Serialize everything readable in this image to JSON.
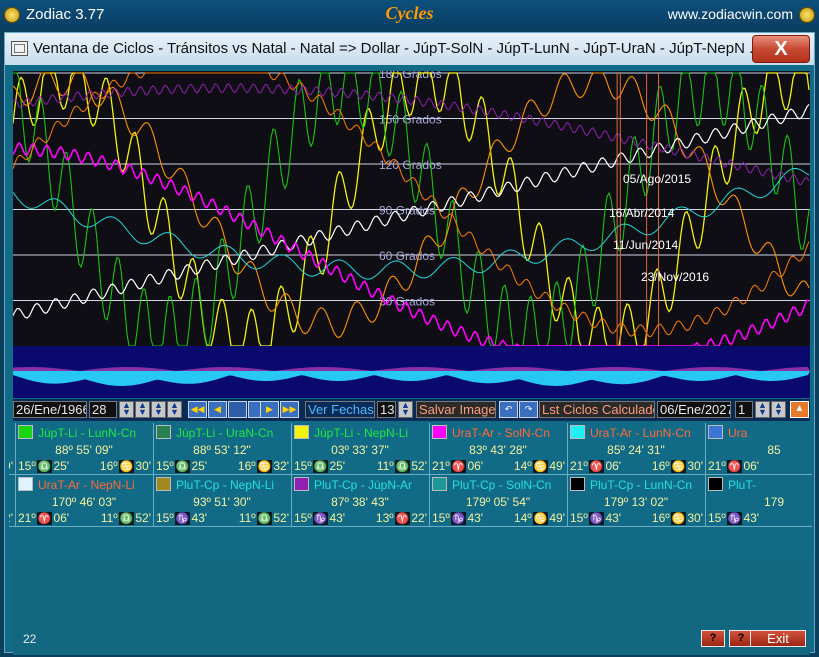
{
  "app": {
    "name": "Zodiac 3.77",
    "module": "Cycles",
    "url": "www.zodiacwin.com"
  },
  "window": {
    "title": "Ventana de Ciclos - Tránsitos vs Natal - Natal => Dollar - JúpT-SolN - JúpT-LunN - JúpT-UraN - JúpT-NepN ...",
    "close": "X"
  },
  "chart_data": {
    "type": "line",
    "y_unit": "Grados",
    "ylim": [
      0,
      180
    ],
    "grid_lines": [
      {
        "value": 180,
        "label": "180 Grados"
      },
      {
        "value": 150,
        "label": "150 Grados"
      },
      {
        "value": 120,
        "label": "120 Grados"
      },
      {
        "value": 90,
        "label": "90 Grados"
      },
      {
        "value": 60,
        "label": "60 Grados"
      },
      {
        "value": 30,
        "label": "30 Grados"
      }
    ],
    "date_markers": [
      {
        "date": "05/Ago/2015",
        "x_frac": 0.795
      },
      {
        "date": "16/Abr/2014",
        "x_frac": 0.758
      },
      {
        "date": "11/Jun/2014",
        "x_frac": 0.762
      },
      {
        "date": "23/Nov/2016",
        "x_frac": 0.81
      }
    ],
    "series_colors": {
      "JúpT-SolN": "#ff9100",
      "JúpT-LunN": "#18c414",
      "JúpT-UraN": "#30a060",
      "JúpT-NepN": "#f2f20e",
      "UraT-SolN": "#ff00ff",
      "UraT-LunN": "#20d8d8",
      "UraT-NepN": "#ffffff",
      "PluT-NepN": "#a08a20",
      "PluT-JúpN": "#9020b0",
      "PluT-SolN": "#209898",
      "PluT-LunN": "#303030"
    }
  },
  "toolbar": {
    "start_date": "26/Ene/1966",
    "step": "28",
    "ver_fechas": "Ver Fechas",
    "ver_count": "13",
    "save_image": "Salvar Imagen",
    "list_calc": "Lst Ciclos Calculados",
    "end_date": "06/Ene/2027",
    "end_step": "1"
  },
  "rows": [
    [
      {
        "title": "-SolN-Cn",
        "title_color": "#25e0e0",
        "value": "",
        "left": "13\"",
        "left_glyph": "",
        "right": "14º",
        "right_glyph": "♋",
        "right_min": "49'",
        "swatch": ""
      },
      {
        "title": "JúpT-Li - LunN-Cn",
        "title_color": "#20e840",
        "value": "88º 55' 09\"",
        "left": "15º",
        "left_glyph": "♎",
        "left_min": "25'",
        "right": "16º",
        "right_glyph": "♋",
        "right_min": "30'",
        "swatch": "#18d414"
      },
      {
        "title": "JúpT-Li - UraN-Cn",
        "title_color": "#20e840",
        "value": "88º 53' 12\"",
        "left": "15º",
        "left_glyph": "♎",
        "left_min": "25'",
        "right": "16º",
        "right_glyph": "♋",
        "right_min": "32'",
        "swatch": "#2a8050"
      },
      {
        "title": "JúpT-Li - NepN-Li",
        "title_color": "#20e840",
        "value": "03º 33' 37\"",
        "left": "15º",
        "left_glyph": "♎",
        "left_min": "25'",
        "right": "11º",
        "right_glyph": "♎",
        "right_min": "52'",
        "swatch": "#f2f20e"
      },
      {
        "title": "UraT-Ar - SolN-Cn",
        "title_color": "#ff6a3a",
        "value": "83º 43' 28\"",
        "left": "21º",
        "left_glyph": "♈",
        "left_min": "06'",
        "right": "14º",
        "right_glyph": "♋",
        "right_min": "49'",
        "swatch": "#ff00ff"
      },
      {
        "title": "UraT-Ar - LunN-Cn",
        "title_color": "#ff6a3a",
        "value": "85º 24' 31\"",
        "left": "21º",
        "left_glyph": "♈",
        "left_min": "06'",
        "right": "16º",
        "right_glyph": "♋",
        "right_min": "30'",
        "swatch": "#20f0f0"
      },
      {
        "title": "Ura",
        "title_color": "#ff6a3a",
        "value": "85",
        "left": "21º",
        "left_glyph": "♈",
        "left_min": "06'",
        "right": "",
        "right_glyph": "",
        "right_min": "",
        "swatch": "#3c74d8"
      }
    ],
    [
      {
        "title": "- JúpN-Ar",
        "title_color": "#25e0e0",
        "value": "",
        "left": "44\"",
        "left_glyph": "",
        "right": "13º",
        "right_glyph": "♈",
        "right_min": "22'",
        "swatch": ""
      },
      {
        "title": "UraT-Ar - NepN-Li",
        "title_color": "#ff6a3a",
        "value": "170º 46' 03\"",
        "left": "21º",
        "left_glyph": "♈",
        "left_min": "06'",
        "right": "11º",
        "right_glyph": "♎",
        "right_min": "52'",
        "swatch": "#e0f4ff"
      },
      {
        "title": "PluT-Cp - NepN-Li",
        "title_color": "#25e0e0",
        "value": "93º 51' 30\"",
        "left": "15º",
        "left_glyph": "♑",
        "left_min": "43'",
        "right": "11º",
        "right_glyph": "♎",
        "right_min": "52'",
        "swatch": "#a08a20"
      },
      {
        "title": "PluT-Cp - JúpN-Ar",
        "title_color": "#25e0e0",
        "value": "87º 38' 43\"",
        "left": "15º",
        "left_glyph": "♑",
        "left_min": "43'",
        "right": "13º",
        "right_glyph": "♈",
        "right_min": "22'",
        "swatch": "#9020b0"
      },
      {
        "title": "PluT-Cp - SolN-Cn",
        "title_color": "#25e0e0",
        "value": "179º 05' 54\"",
        "left": "15º",
        "left_glyph": "♑",
        "left_min": "43'",
        "right": "14º",
        "right_glyph": "♋",
        "right_min": "49'",
        "swatch": "#209898"
      },
      {
        "title": "PluT-Cp - LunN-Cn",
        "title_color": "#25e0e0",
        "value": "179º 13' 02\"",
        "left": "15º",
        "left_glyph": "♑",
        "left_min": "43'",
        "right": "16º",
        "right_glyph": "♋",
        "right_min": "30'",
        "swatch": "#000000"
      },
      {
        "title": "PluT-",
        "title_color": "#25e0e0",
        "value": "179",
        "left": "15º",
        "left_glyph": "♑",
        "left_min": "43'",
        "right": "",
        "right_glyph": "",
        "right_min": "",
        "swatch": "#000000"
      }
    ]
  ],
  "status": {
    "text": "22",
    "help1": "?",
    "help2": "?",
    "exit": "Exit"
  }
}
